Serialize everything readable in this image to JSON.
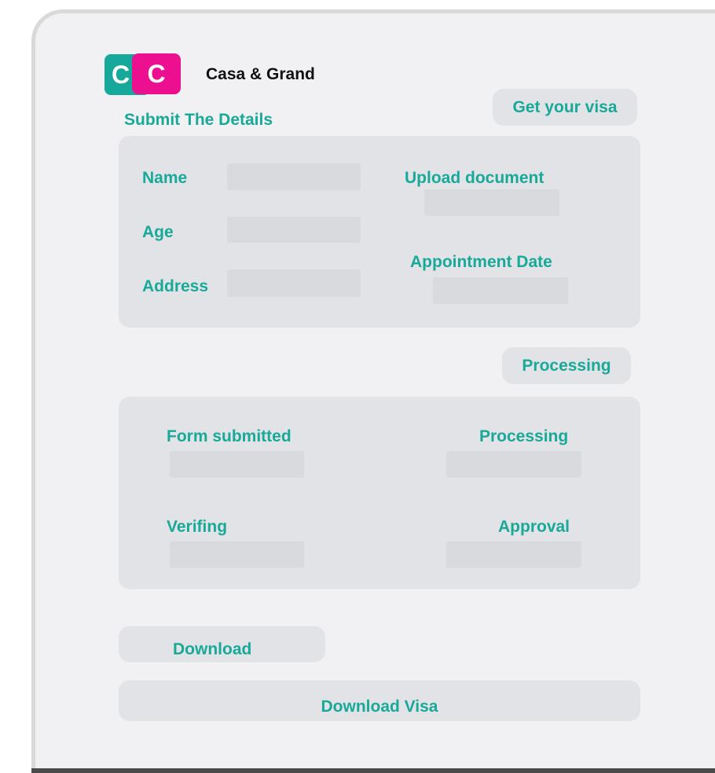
{
  "brand": {
    "logo_letter_1": "C",
    "logo_letter_2": "C",
    "name": "Casa & Grand"
  },
  "header": {
    "get_visa_button": "Get your visa",
    "section_title": "Submit The Details"
  },
  "form": {
    "name_label": "Name",
    "age_label": "Age",
    "address_label": "Address",
    "upload_label": "Upload document",
    "appointment_label": "Appointment Date"
  },
  "status": {
    "processing_button": "Processing",
    "form_submitted_label": "Form submitted",
    "processing_label": "Processing",
    "verifying_label": "Verifing",
    "approval_label": "Approval"
  },
  "actions": {
    "download_button": "Download",
    "download_visa_button": "Download Visa"
  },
  "colors": {
    "accent_teal": "#18a999",
    "logo_teal": "#16a89b",
    "logo_pink": "#ec0f8f",
    "panel_gray": "#e2e3e6",
    "background": "#f1f1f3"
  }
}
